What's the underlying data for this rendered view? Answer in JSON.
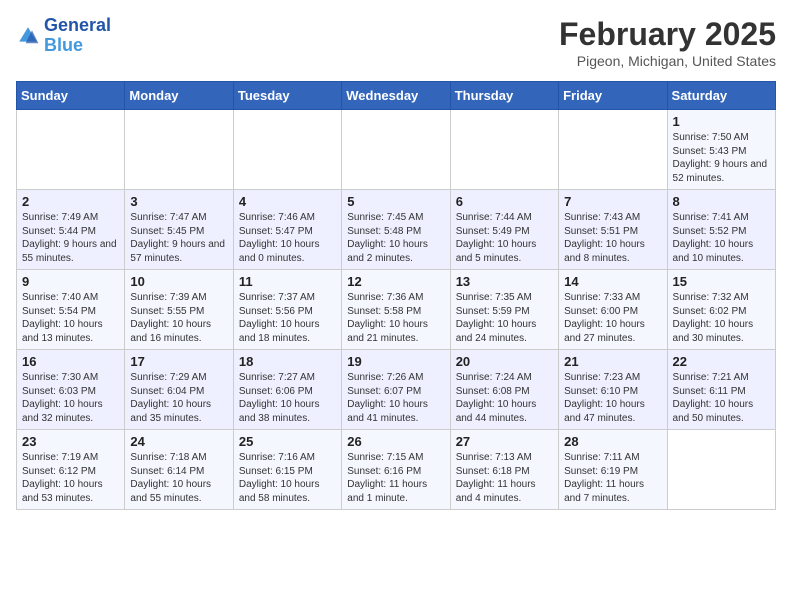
{
  "header": {
    "logo_line1": "General",
    "logo_line2": "Blue",
    "month": "February 2025",
    "location": "Pigeon, Michigan, United States"
  },
  "weekdays": [
    "Sunday",
    "Monday",
    "Tuesday",
    "Wednesday",
    "Thursday",
    "Friday",
    "Saturday"
  ],
  "weeks": [
    [
      {
        "day": "",
        "info": ""
      },
      {
        "day": "",
        "info": ""
      },
      {
        "day": "",
        "info": ""
      },
      {
        "day": "",
        "info": ""
      },
      {
        "day": "",
        "info": ""
      },
      {
        "day": "",
        "info": ""
      },
      {
        "day": "1",
        "info": "Sunrise: 7:50 AM\nSunset: 5:43 PM\nDaylight: 9 hours and 52 minutes."
      }
    ],
    [
      {
        "day": "2",
        "info": "Sunrise: 7:49 AM\nSunset: 5:44 PM\nDaylight: 9 hours and 55 minutes."
      },
      {
        "day": "3",
        "info": "Sunrise: 7:47 AM\nSunset: 5:45 PM\nDaylight: 9 hours and 57 minutes."
      },
      {
        "day": "4",
        "info": "Sunrise: 7:46 AM\nSunset: 5:47 PM\nDaylight: 10 hours and 0 minutes."
      },
      {
        "day": "5",
        "info": "Sunrise: 7:45 AM\nSunset: 5:48 PM\nDaylight: 10 hours and 2 minutes."
      },
      {
        "day": "6",
        "info": "Sunrise: 7:44 AM\nSunset: 5:49 PM\nDaylight: 10 hours and 5 minutes."
      },
      {
        "day": "7",
        "info": "Sunrise: 7:43 AM\nSunset: 5:51 PM\nDaylight: 10 hours and 8 minutes."
      },
      {
        "day": "8",
        "info": "Sunrise: 7:41 AM\nSunset: 5:52 PM\nDaylight: 10 hours and 10 minutes."
      }
    ],
    [
      {
        "day": "9",
        "info": "Sunrise: 7:40 AM\nSunset: 5:54 PM\nDaylight: 10 hours and 13 minutes."
      },
      {
        "day": "10",
        "info": "Sunrise: 7:39 AM\nSunset: 5:55 PM\nDaylight: 10 hours and 16 minutes."
      },
      {
        "day": "11",
        "info": "Sunrise: 7:37 AM\nSunset: 5:56 PM\nDaylight: 10 hours and 18 minutes."
      },
      {
        "day": "12",
        "info": "Sunrise: 7:36 AM\nSunset: 5:58 PM\nDaylight: 10 hours and 21 minutes."
      },
      {
        "day": "13",
        "info": "Sunrise: 7:35 AM\nSunset: 5:59 PM\nDaylight: 10 hours and 24 minutes."
      },
      {
        "day": "14",
        "info": "Sunrise: 7:33 AM\nSunset: 6:00 PM\nDaylight: 10 hours and 27 minutes."
      },
      {
        "day": "15",
        "info": "Sunrise: 7:32 AM\nSunset: 6:02 PM\nDaylight: 10 hours and 30 minutes."
      }
    ],
    [
      {
        "day": "16",
        "info": "Sunrise: 7:30 AM\nSunset: 6:03 PM\nDaylight: 10 hours and 32 minutes."
      },
      {
        "day": "17",
        "info": "Sunrise: 7:29 AM\nSunset: 6:04 PM\nDaylight: 10 hours and 35 minutes."
      },
      {
        "day": "18",
        "info": "Sunrise: 7:27 AM\nSunset: 6:06 PM\nDaylight: 10 hours and 38 minutes."
      },
      {
        "day": "19",
        "info": "Sunrise: 7:26 AM\nSunset: 6:07 PM\nDaylight: 10 hours and 41 minutes."
      },
      {
        "day": "20",
        "info": "Sunrise: 7:24 AM\nSunset: 6:08 PM\nDaylight: 10 hours and 44 minutes."
      },
      {
        "day": "21",
        "info": "Sunrise: 7:23 AM\nSunset: 6:10 PM\nDaylight: 10 hours and 47 minutes."
      },
      {
        "day": "22",
        "info": "Sunrise: 7:21 AM\nSunset: 6:11 PM\nDaylight: 10 hours and 50 minutes."
      }
    ],
    [
      {
        "day": "23",
        "info": "Sunrise: 7:19 AM\nSunset: 6:12 PM\nDaylight: 10 hours and 53 minutes."
      },
      {
        "day": "24",
        "info": "Sunrise: 7:18 AM\nSunset: 6:14 PM\nDaylight: 10 hours and 55 minutes."
      },
      {
        "day": "25",
        "info": "Sunrise: 7:16 AM\nSunset: 6:15 PM\nDaylight: 10 hours and 58 minutes."
      },
      {
        "day": "26",
        "info": "Sunrise: 7:15 AM\nSunset: 6:16 PM\nDaylight: 11 hours and 1 minute."
      },
      {
        "day": "27",
        "info": "Sunrise: 7:13 AM\nSunset: 6:18 PM\nDaylight: 11 hours and 4 minutes."
      },
      {
        "day": "28",
        "info": "Sunrise: 7:11 AM\nSunset: 6:19 PM\nDaylight: 11 hours and 7 minutes."
      },
      {
        "day": "",
        "info": ""
      }
    ]
  ]
}
